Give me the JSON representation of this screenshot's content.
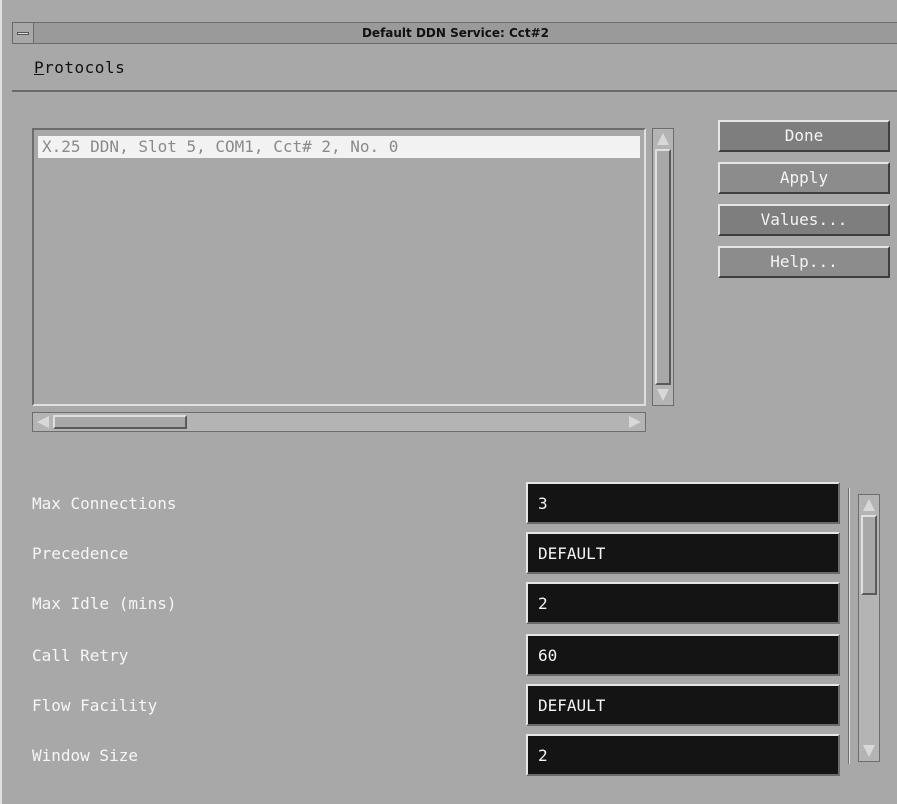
{
  "window": {
    "title": "Default DDN Service: Cct#2"
  },
  "menubar": {
    "protocols_mnemonic": "P",
    "protocols_rest": "rotocols"
  },
  "list": {
    "items": [
      "X.25 DDN, Slot 5, COM1, Cct# 2, No. 0"
    ]
  },
  "buttons": {
    "done": "Done",
    "apply": "Apply",
    "values": "Values...",
    "help": "Help..."
  },
  "form": {
    "fields": [
      {
        "label": "Max Connections",
        "value": "3"
      },
      {
        "label": "Precedence",
        "value": "DEFAULT"
      },
      {
        "label": "Max Idle (mins)",
        "value": "2"
      },
      {
        "label": "Call Retry",
        "value": "60"
      },
      {
        "label": "Flow Facility",
        "value": "DEFAULT"
      },
      {
        "label": "Window Size",
        "value": "2"
      }
    ]
  },
  "icons": {
    "window_menu": "minus-bar-icon",
    "scroll_up": "triangle-up-icon",
    "scroll_down": "triangle-down-icon",
    "scroll_left": "triangle-left-icon",
    "scroll_right": "triangle-right-icon"
  },
  "colors": {
    "background": "#a8a8a8",
    "field_bg": "#141414",
    "field_text": "#f4f4f4",
    "button_bg": "#8c8c8c",
    "selected_row_bg": "#f2f2f2"
  }
}
